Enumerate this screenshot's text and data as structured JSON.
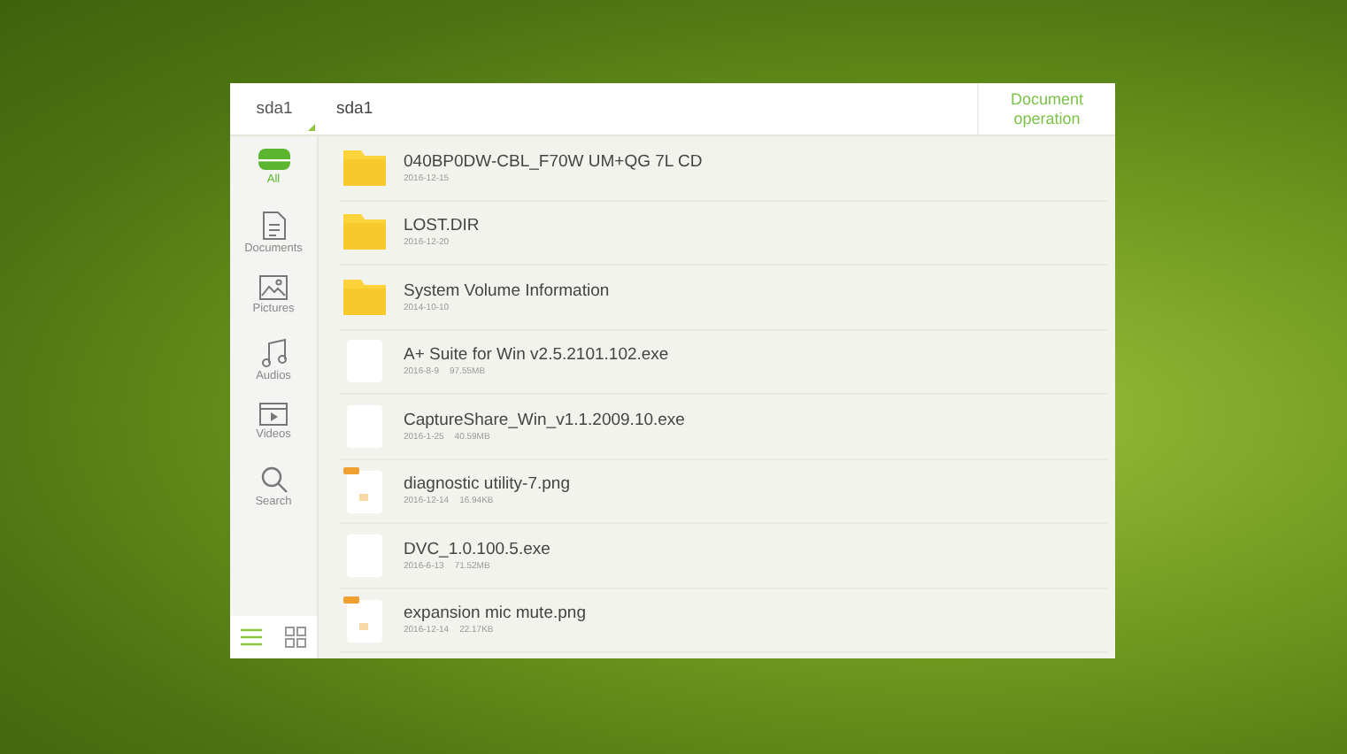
{
  "breadcrumbs": [
    {
      "label": "sda1",
      "selected": false
    },
    {
      "label": "sda1",
      "selected": true
    }
  ],
  "header_action": "Document operation",
  "sidebar": {
    "items": [
      {
        "kind": "all",
        "label": "All",
        "selected": true
      },
      {
        "kind": "documents",
        "label": "Documents",
        "selected": false
      },
      {
        "kind": "pictures",
        "label": "Pictures",
        "selected": false
      },
      {
        "kind": "audios",
        "label": "Audios",
        "selected": false
      },
      {
        "kind": "videos",
        "label": "Videos",
        "selected": false
      },
      {
        "kind": "search",
        "label": "Search",
        "selected": false
      }
    ],
    "view_modes": [
      {
        "kind": "list",
        "selected": true
      },
      {
        "kind": "grid",
        "selected": false
      }
    ]
  },
  "files": [
    {
      "kind": "folder",
      "name": "040BP0DW-CBL_F70W UM+QG 7L CD",
      "date": "2016-12-15"
    },
    {
      "kind": "folder",
      "name": "LOST.DIR",
      "date": "2016-12-20"
    },
    {
      "kind": "folder",
      "name": "System Volume Information",
      "date": "2014-10-10"
    },
    {
      "kind": "file",
      "name": "A+ Suite for Win v2.5.2101.102.exe",
      "date": "2016-8-9",
      "size": "97.55MB"
    },
    {
      "kind": "file",
      "name": "CaptureShare_Win_v1.1.2009.10.exe",
      "date": "2016-1-25",
      "size": "40.59MB"
    },
    {
      "kind": "image",
      "name": "diagnostic utility-7.png",
      "date": "2016-12-14",
      "size": "16.94KB"
    },
    {
      "kind": "file",
      "name": "DVC_1.0.100.5.exe",
      "date": "2016-6-13",
      "size": "71.52MB"
    },
    {
      "kind": "image",
      "name": "expansion mic mute.png",
      "date": "2016-12-14",
      "size": "22.17KB"
    }
  ]
}
